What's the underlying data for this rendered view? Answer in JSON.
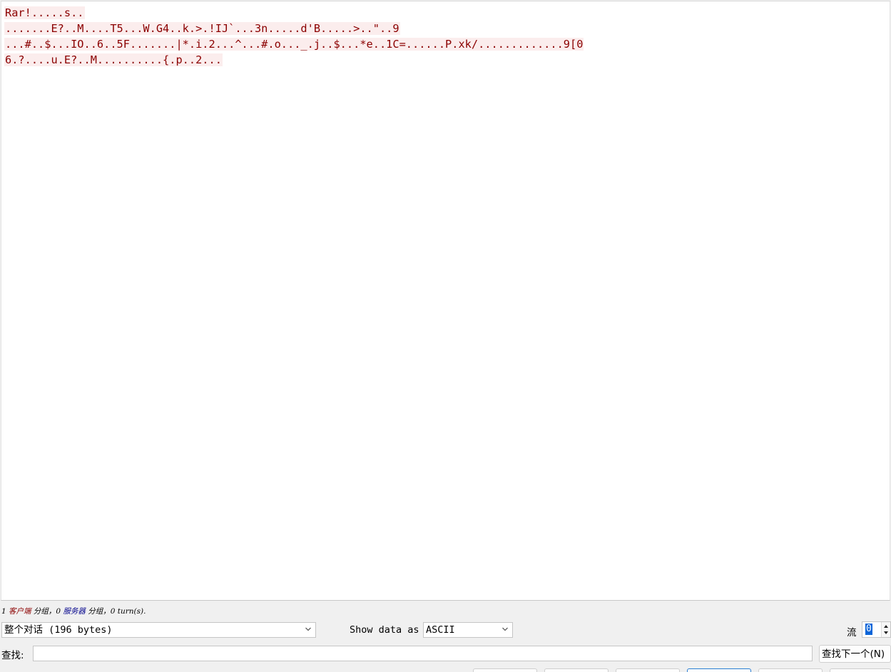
{
  "stream": {
    "lines": [
      "Rar!.....s..",
      ".......E?..M....T5...W.G4..k.>.!IJ`...3n.....d'B.....>..\"..9",
      "...#..$...IO..6..5F.......|*.i.2...^...#.o..._.j..$...*e..1C=......P.xk/.............9[0",
      "6.?....u.E?..M..........{.p..2..."
    ]
  },
  "status": {
    "client_count": "1",
    "client_label": "客户端",
    "packets_label_1": "分组，",
    "server_count": "0",
    "server_label": "服务器",
    "packets_label_2": "分组，",
    "turns_text": "0 turn(s)."
  },
  "controls": {
    "conversation_select_value": "整个对话 (196 bytes)",
    "show_data_as_label": "Show data as",
    "show_data_as_value": "ASCII",
    "stream_label": "流",
    "stream_number": "0",
    "find_label": "查找:",
    "find_value": "",
    "find_next_button": "查找下一个(N)"
  },
  "icons": {
    "dropdown": "chevron-down-icon",
    "spinner_up": "spin-up-icon",
    "spinner_down": "spin-down-icon"
  },
  "colors": {
    "client_text": "#8b0000",
    "client_bg": "#fbeded",
    "server_text": "#00008b",
    "selection": "#0a64d8"
  }
}
